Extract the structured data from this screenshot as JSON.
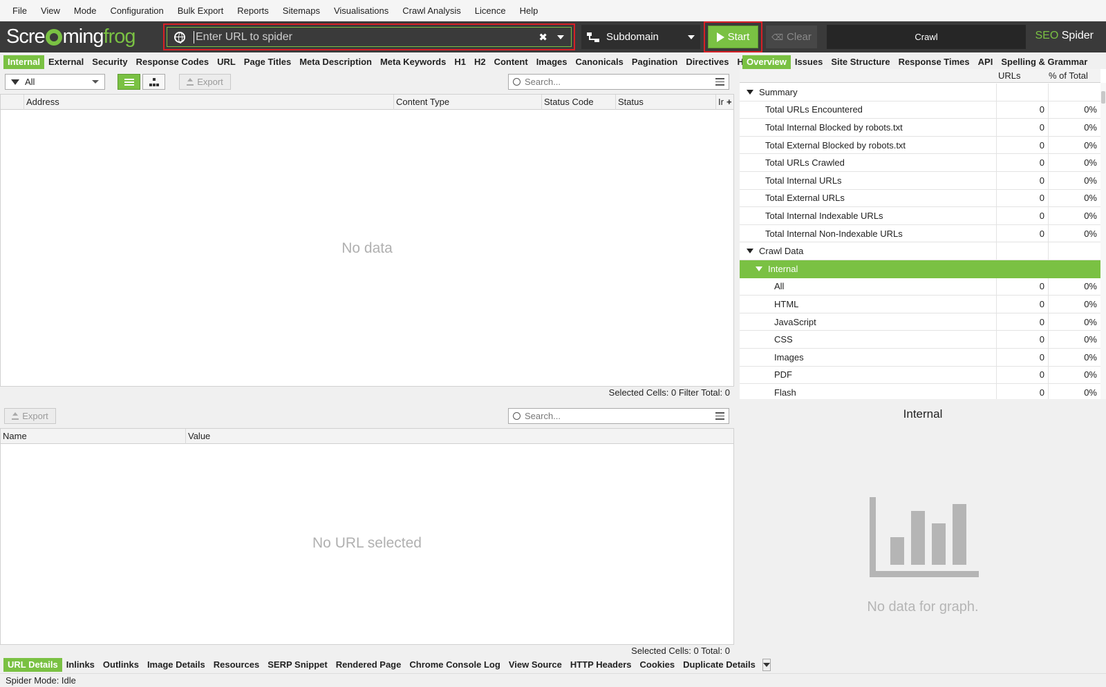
{
  "menu": [
    "File",
    "View",
    "Mode",
    "Configuration",
    "Bulk Export",
    "Reports",
    "Sitemaps",
    "Visualisations",
    "Crawl Analysis",
    "Licence",
    "Help"
  ],
  "toolbar": {
    "logo_white": "Scre",
    "logo_mid": "ming",
    "logo_green": "frog",
    "url_placeholder": "Enter URL to spider",
    "mode": "Subdomain",
    "start_label": "Start",
    "clear_label": "Clear",
    "crawl_label": "Crawl",
    "brand_seo": "SEO",
    "brand_spider": "Spider"
  },
  "colors": {
    "accent": "#7ac143",
    "highlight": "#d81f26",
    "toolbar": "#3a3a3a"
  },
  "main_tabs": [
    "Internal",
    "External",
    "Security",
    "Response Codes",
    "URL",
    "Page Titles",
    "Meta Description",
    "Meta Keywords",
    "H1",
    "H2",
    "Content",
    "Images",
    "Canonicals",
    "Pagination",
    "Directives",
    "H"
  ],
  "filter": {
    "value": "All"
  },
  "export_label": "Export",
  "search_placeholder": "Search...",
  "main_table": {
    "columns": [
      "Address",
      "Content Type",
      "Status Code",
      "Status",
      "Ir"
    ],
    "empty": "No data",
    "status_selected": "Selected Cells:  0  Filter Total:  0"
  },
  "right_tabs": [
    "Overview",
    "Issues",
    "Site Structure",
    "Response Times",
    "API",
    "Spelling & Grammar"
  ],
  "overview": {
    "col_urls": "URLs",
    "col_pct": "% of Total",
    "rows": [
      {
        "label": "Summary",
        "type": "group",
        "indent": 0
      },
      {
        "label": "Total URLs Encountered",
        "urls": "0",
        "pct": "0%",
        "indent": 1
      },
      {
        "label": "Total Internal Blocked by robots.txt",
        "urls": "0",
        "pct": "0%",
        "indent": 1
      },
      {
        "label": "Total External Blocked by robots.txt",
        "urls": "0",
        "pct": "0%",
        "indent": 1
      },
      {
        "label": "Total URLs Crawled",
        "urls": "0",
        "pct": "0%",
        "indent": 1
      },
      {
        "label": "Total Internal URLs",
        "urls": "0",
        "pct": "0%",
        "indent": 1
      },
      {
        "label": "Total External URLs",
        "urls": "0",
        "pct": "0%",
        "indent": 1
      },
      {
        "label": "Total Internal Indexable URLs",
        "urls": "0",
        "pct": "0%",
        "indent": 1
      },
      {
        "label": "Total Internal Non-Indexable URLs",
        "urls": "0",
        "pct": "0%",
        "indent": 1
      },
      {
        "label": "Crawl Data",
        "type": "group",
        "indent": 0
      },
      {
        "label": "Internal",
        "type": "group",
        "indent": 1,
        "selected": true
      },
      {
        "label": "All",
        "urls": "0",
        "pct": "0%",
        "indent": 2
      },
      {
        "label": "HTML",
        "urls": "0",
        "pct": "0%",
        "indent": 2
      },
      {
        "label": "JavaScript",
        "urls": "0",
        "pct": "0%",
        "indent": 2
      },
      {
        "label": "CSS",
        "urls": "0",
        "pct": "0%",
        "indent": 2
      },
      {
        "label": "Images",
        "urls": "0",
        "pct": "0%",
        "indent": 2
      },
      {
        "label": "PDF",
        "urls": "0",
        "pct": "0%",
        "indent": 2
      },
      {
        "label": "Flash",
        "urls": "0",
        "pct": "0%",
        "indent": 2
      }
    ]
  },
  "details_table": {
    "columns": [
      "Name",
      "Value"
    ],
    "empty": "No URL selected",
    "status_selected": "Selected Cells:  0  Total:  0"
  },
  "graph_panel": {
    "title": "Internal",
    "empty": "No data for graph."
  },
  "bottom_tabs": [
    "URL Details",
    "Inlinks",
    "Outlinks",
    "Image Details",
    "Resources",
    "SERP Snippet",
    "Rendered Page",
    "Chrome Console Log",
    "View Source",
    "HTTP Headers",
    "Cookies",
    "Duplicate Details"
  ],
  "status_bar": "Spider Mode: Idle"
}
